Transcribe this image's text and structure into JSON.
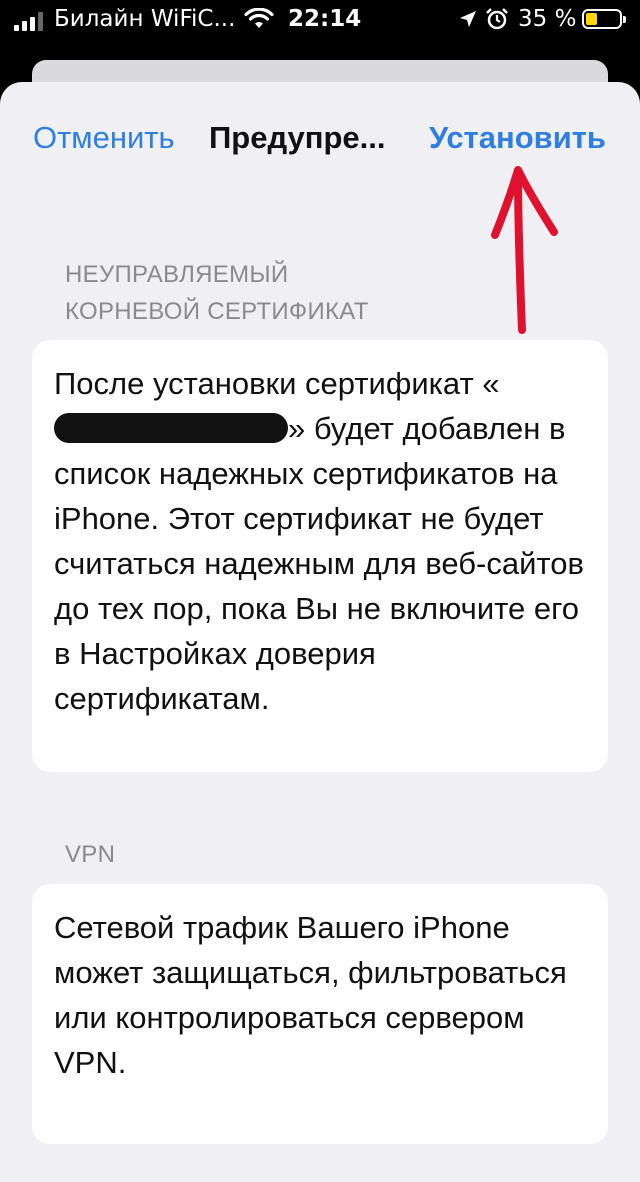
{
  "status_bar": {
    "carrier": "Билайн WiFiC...",
    "time": "22:14",
    "battery_pct": "35 %",
    "battery_level": 0.35,
    "icons": [
      "signal-icon",
      "wifi-icon",
      "location-icon",
      "alarm-icon",
      "battery-icon"
    ],
    "battery_color": "#ffd60a"
  },
  "nav": {
    "cancel_label": "Отменить",
    "title": "Предупре...",
    "install_label": "Установить"
  },
  "sections": [
    {
      "header_line1": "НЕУПРАВЛЯЕМЫЙ",
      "header_line2": "КОРНЕВОЙ СЕРТИФИКАТ",
      "text_before": "После установки сертификат «",
      "text_after": "» будет добавлен в список надежных сертификатов на iPhone. Этот сертификат не будет считаться надежным для веб-сайтов до тех пор, пока Вы не включите его в Настройках доверия сертификатам."
    },
    {
      "header": "VPN",
      "text": "Сетевой трафик Вашего iPhone может защищаться, фильтроваться или контролироваться сервером VPN."
    }
  ],
  "colors": {
    "accent": "#2e7fe0",
    "annotation_arrow": "#e0102f",
    "background": "#efeff4"
  }
}
